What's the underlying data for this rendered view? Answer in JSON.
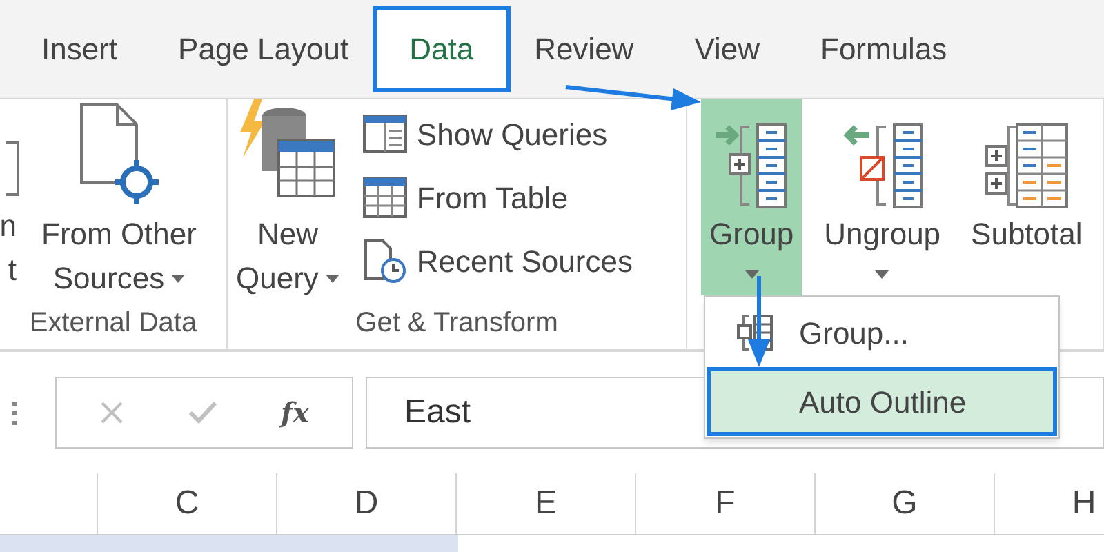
{
  "tabs": [
    {
      "label": "Insert",
      "selected": false
    },
    {
      "label": "Page Layout",
      "selected": false
    },
    {
      "label": "Data",
      "selected": true
    },
    {
      "label": "Review",
      "selected": false
    },
    {
      "label": "View",
      "selected": false
    },
    {
      "label": "Formulas",
      "selected": false
    }
  ],
  "ribbon_groups": [
    {
      "label": "External Data",
      "items": [
        {
          "kind": "partial",
          "lines": [
            "n",
            "t"
          ]
        },
        {
          "kind": "menu",
          "lines": [
            "From Other",
            "Sources"
          ],
          "pressed": false
        }
      ]
    },
    {
      "label": "Get & Transform",
      "items": [
        {
          "kind": "menu",
          "lines": [
            "New",
            "Query"
          ],
          "pressed": false
        },
        {
          "kind": "stack",
          "entries": [
            {
              "label": "Show Queries"
            },
            {
              "label": "From Table"
            },
            {
              "label": "Recent Sources"
            }
          ]
        }
      ]
    },
    {
      "items": [
        {
          "kind": "split",
          "lines": [
            "Group"
          ],
          "pressed": true
        },
        {
          "kind": "split",
          "lines": [
            "Ungroup"
          ],
          "pressed": false
        },
        {
          "kind": "large",
          "lines": [
            "Subtotal"
          ],
          "pressed": false
        }
      ]
    }
  ],
  "group_menu": {
    "items": [
      {
        "label": "Group...",
        "selected": false
      },
      {
        "label": "Auto Outline",
        "selected": true
      }
    ]
  },
  "formula_bar": {
    "function_label": "fx",
    "value": "East"
  },
  "columns": [
    "C",
    "D",
    "E",
    "F",
    "G",
    "H"
  ]
}
